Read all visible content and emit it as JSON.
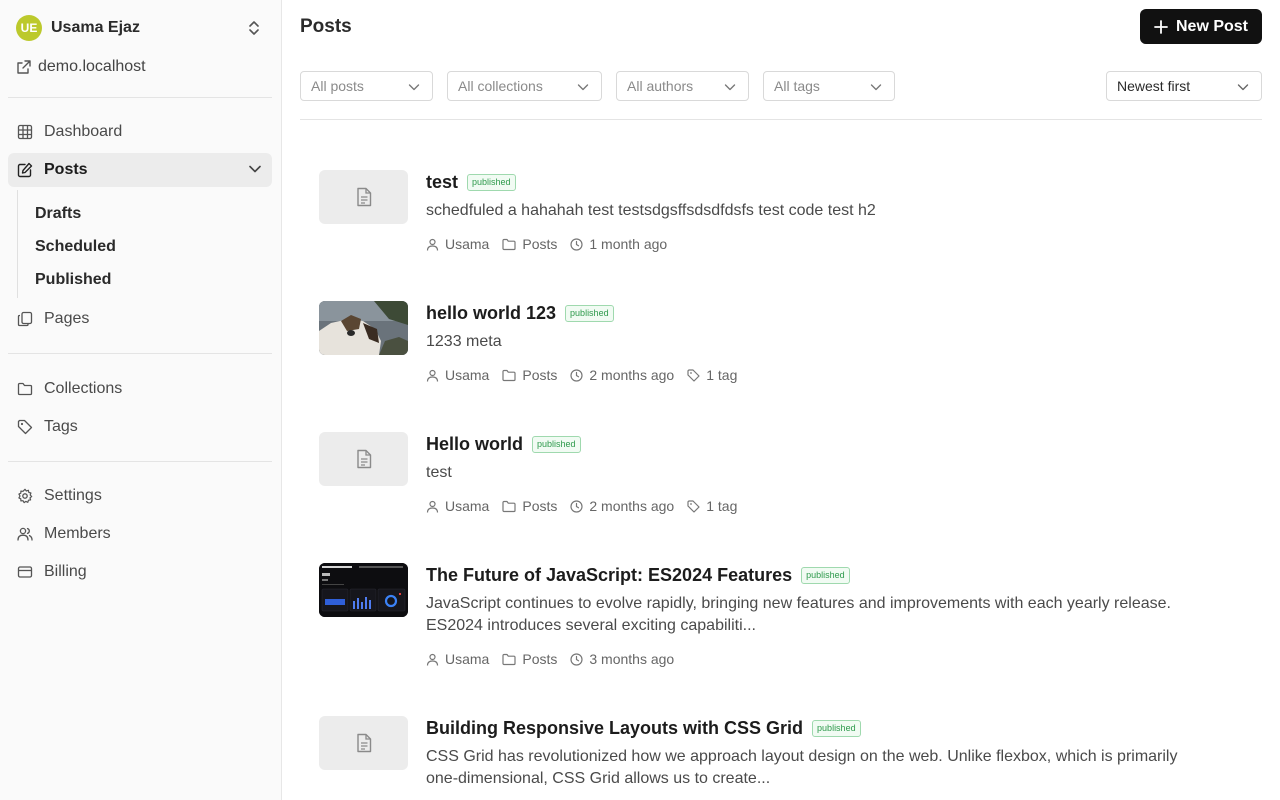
{
  "sidebar": {
    "user": {
      "initials": "UE",
      "name": "Usama Ejaz"
    },
    "site": "demo.localhost",
    "nav": {
      "dashboard": "Dashboard",
      "posts": "Posts",
      "drafts": "Drafts",
      "scheduled": "Scheduled",
      "published": "Published",
      "pages": "Pages",
      "collections": "Collections",
      "tags": "Tags",
      "settings": "Settings",
      "members": "Members",
      "billing": "Billing"
    }
  },
  "header": {
    "title": "Posts",
    "new_post_label": "New Post"
  },
  "filters": {
    "status": "All posts",
    "collections": "All collections",
    "authors": "All authors",
    "tags": "All tags",
    "sort": "Newest first"
  },
  "posts": [
    {
      "title": "test",
      "status": "published",
      "excerpt": "schedfuled a hahahah test testsdgsffsdsdfdsfs test code test h2",
      "author": "Usama",
      "collection": "Posts",
      "time": "1 month ago",
      "tags": "",
      "thumbnail": "placeholder"
    },
    {
      "title": "hello world 123",
      "status": "published",
      "excerpt": "1233 meta",
      "author": "Usama",
      "collection": "Posts",
      "time": "2 months ago",
      "tags": "1 tag",
      "thumbnail": "cat-photo"
    },
    {
      "title": "Hello world",
      "status": "published",
      "excerpt": "test",
      "author": "Usama",
      "collection": "Posts",
      "time": "2 months ago",
      "tags": "1 tag",
      "thumbnail": "placeholder"
    },
    {
      "title": "The Future of JavaScript: ES2024 Features",
      "status": "published",
      "excerpt": "JavaScript continues to evolve rapidly, bringing new features and improvements with each yearly release. ES2024 introduces several exciting capabiliti...",
      "author": "Usama",
      "collection": "Posts",
      "time": "3 months ago",
      "tags": "",
      "thumbnail": "dashboard-screenshot"
    },
    {
      "title": "Building Responsive Layouts with CSS Grid",
      "status": "published",
      "excerpt": "CSS Grid has revolutionized how we approach layout design on the web. Unlike flexbox, which is primarily one-dimensional, CSS Grid allows us to create...",
      "author": "",
      "collection": "",
      "time": "",
      "tags": "",
      "thumbnail": "placeholder"
    }
  ],
  "colors": {
    "avatar": "#bcc92c",
    "primary_button": "#111111",
    "badge_green": "#2e9a4c"
  }
}
